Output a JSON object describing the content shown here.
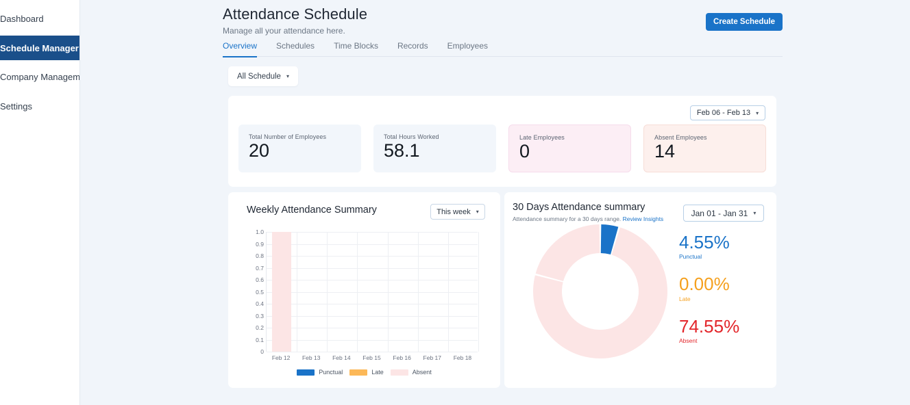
{
  "sidebar": {
    "items": [
      {
        "label": "Dashboard",
        "active": false
      },
      {
        "label": "Schedule Manager",
        "active": true
      },
      {
        "label": "Company Management",
        "active": false
      },
      {
        "label": "Settings",
        "active": false
      }
    ]
  },
  "header": {
    "title": "Attendance Schedule",
    "subtitle": "Manage all your attendance here.",
    "create_button": "Create Schedule"
  },
  "tabs": [
    {
      "label": "Overview",
      "active": true
    },
    {
      "label": "Schedules",
      "active": false
    },
    {
      "label": "Time Blocks",
      "active": false
    },
    {
      "label": "Records",
      "active": false
    },
    {
      "label": "Employees",
      "active": false
    }
  ],
  "filter": {
    "schedule_select": "All Schedule",
    "caret": "▾"
  },
  "stats": {
    "date_range": "Feb 06 - Feb 13",
    "caret": "▾",
    "cards": [
      {
        "label": "Total Number of Employees",
        "value": "20",
        "tone": "neutral"
      },
      {
        "label": "Total Hours Worked",
        "value": "58.1",
        "tone": "neutral"
      },
      {
        "label": "Late Employees",
        "value": "0",
        "tone": "pink"
      },
      {
        "label": "Absent Employees",
        "value": "14",
        "tone": "peach"
      }
    ]
  },
  "weekly": {
    "title": "Weekly Attendance Summary",
    "period_select": "This week",
    "caret": "▾"
  },
  "thirty_days": {
    "title": "30 Days Attendance summary",
    "subtitle_text": "Attendance summary for a 30 days range.",
    "subtitle_link": "Review Insights",
    "date_range": "Jan 01 - Jan 31",
    "caret": "▾",
    "metrics": [
      {
        "value": "4.55%",
        "label": "Punctual",
        "color": "#1a73c8"
      },
      {
        "value": "0.00%",
        "label": "Late",
        "color": "#f5a01e"
      },
      {
        "value": "74.55%",
        "label": "Absent",
        "color": "#e3262b"
      }
    ]
  },
  "colors": {
    "punctual": "#1a73c8",
    "late": "#fcb858",
    "absent": "#fce5e5",
    "accent": "#1a73c8",
    "sidebar_active": "#1a4f8a",
    "page_bg": "#f1f5fa"
  },
  "chart_data": [
    {
      "type": "bar",
      "title": "Weekly Attendance Summary",
      "categories": [
        "Feb 12",
        "Feb 13",
        "Feb 14",
        "Feb 15",
        "Feb 16",
        "Feb 17",
        "Feb 18"
      ],
      "series": [
        {
          "name": "Punctual",
          "color": "#1a73c8",
          "values": [
            0,
            0,
            0,
            0,
            0,
            0,
            0
          ]
        },
        {
          "name": "Late",
          "color": "#fcb858",
          "values": [
            0,
            0,
            0,
            0,
            0,
            0,
            0
          ]
        },
        {
          "name": "Absent",
          "color": "#fce5e5",
          "values": [
            1.0,
            0,
            0,
            0,
            0,
            0,
            0
          ]
        }
      ],
      "ytick_labels": [
        "1.0",
        "0.9",
        "0.8",
        "0.7",
        "0.6",
        "0.5",
        "0.4",
        "0.3",
        "0.2",
        "0.1",
        "0"
      ],
      "yticks": [
        1.0,
        0.9,
        0.8,
        0.7,
        0.6,
        0.5,
        0.4,
        0.3,
        0.2,
        0.1,
        0
      ],
      "ylim": [
        0,
        1.0
      ],
      "xlabel": "",
      "ylabel": "",
      "grid": true,
      "legend_position": "bottom",
      "legend": [
        "Punctual",
        "Late",
        "Absent"
      ]
    },
    {
      "type": "pie",
      "title": "30 Days Attendance summary",
      "donut": true,
      "labels": [
        "Punctual",
        "Late",
        "Absent"
      ],
      "values": [
        4.55,
        0.0,
        74.55
      ],
      "display_values": [
        "4.55%",
        "0.00%",
        "74.55%"
      ],
      "colors": [
        "#1a73c8",
        "#f5a01e",
        "#fce5e5"
      ],
      "legend_position": "right"
    }
  ]
}
